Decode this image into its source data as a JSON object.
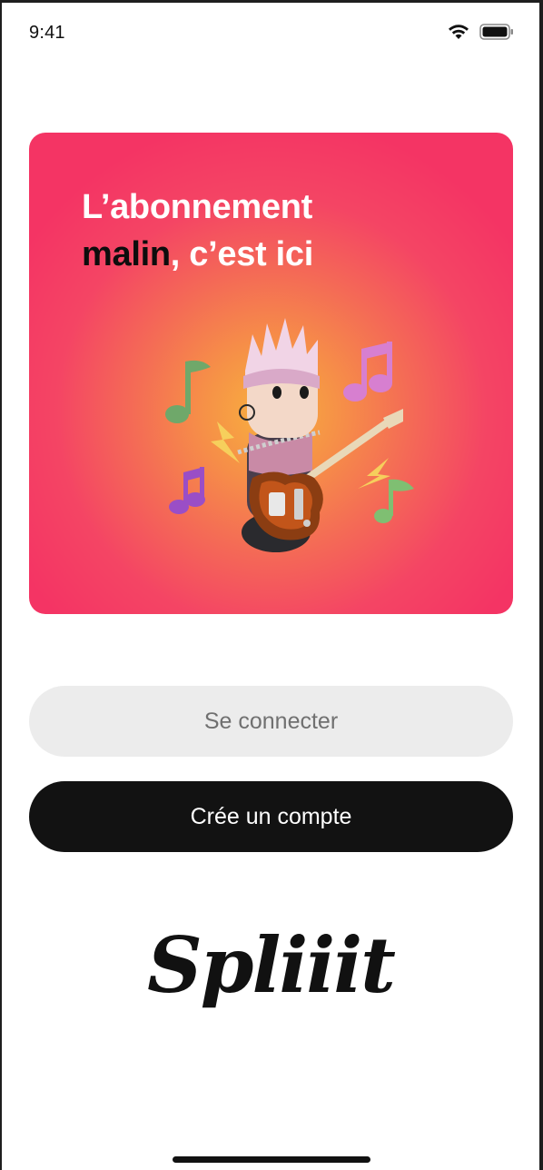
{
  "status_bar": {
    "time": "9:41"
  },
  "hero": {
    "title_line1": "L’abonnement",
    "title_line2_accent": "malin",
    "title_line2_rest": ", c’est ici",
    "gradient_colors": [
      "#f8b23e",
      "#f69147",
      "#f46a56",
      "#f44564",
      "#f43464"
    ]
  },
  "actions": {
    "login_label": "Se connecter",
    "signup_label": "Crée un compte"
  },
  "brand": {
    "logo_text": "Spliiit"
  },
  "icons": [
    "wifi-icon",
    "battery-icon",
    "music-note-icon",
    "lightning-icon",
    "guitar-icon"
  ]
}
